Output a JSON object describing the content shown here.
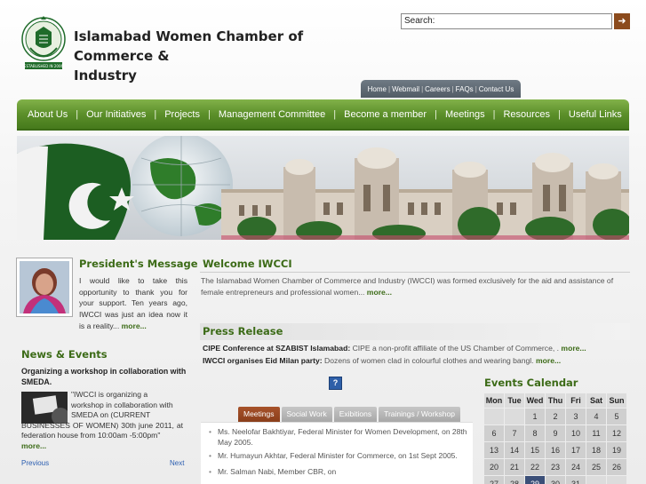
{
  "header": {
    "title_line1": "Islamabad Women Chamber of Commerce &",
    "title_line2": "Industry",
    "logo_caption": "ESTABLISHED IN 2006"
  },
  "search": {
    "label": "Search:",
    "value": "",
    "go_label": "➜"
  },
  "top_links": [
    "Home",
    "Webmail",
    "Careers",
    "FAQs",
    "Contact Us"
  ],
  "nav": [
    "About Us",
    "Our Initiatives",
    "Projects",
    "Management Committee",
    "Become a member",
    "Meetings",
    "Resources",
    "Useful Links"
  ],
  "president": {
    "title": "President's Message",
    "text": "I would like to take this opportunity to thank you for your support. Ten years ago, IWCCI was just an idea now it is a reality...",
    "more": "more..."
  },
  "welcome": {
    "title": "Welcome IWCCI",
    "text": "The Islamabad Women Chamber of Commerce and Industry (IWCCI) was formed exclusively for the aid and assistance of female entrepreneurs and professional women...",
    "more": "more..."
  },
  "press": {
    "title": "Press Release",
    "items": [
      {
        "bold": "CIPE Conference at SZABIST Islamabad:",
        "text": " CIPE a non-profit affiliate of the US Chamber of Commerce, .",
        "more": "more..."
      },
      {
        "bold": "IWCCI organises Eid Milan party:",
        "text": " Dozens of women clad in colourful clothes and wearing bangl.",
        "more": "more..."
      }
    ]
  },
  "news": {
    "title": "News & Events",
    "headline": "Organizing a workshop in collaboration with SMEDA.",
    "body_line1": "\"IWCCI is organizing a",
    "body_line2": "workshop in collaboration with",
    "body_line3": "SMEDA on (CURRENT",
    "body_rest": "BUSINESSES OF WOMEN) 30th june 2011, at federation house from 10:00am -5:00pm\"",
    "more": "more...",
    "prev": "Previous",
    "next": "Next"
  },
  "help_label": "?",
  "tabs": [
    {
      "label": "Meetings",
      "active": true
    },
    {
      "label": "Social Work",
      "active": false
    },
    {
      "label": "Exibitions",
      "active": false
    },
    {
      "label": "Trainings / Workshop",
      "active": false
    }
  ],
  "meetings": [
    "Ms. Neelofar Bakhtiyar, Federal Minister for Women Development, on 28th May 2005.",
    "Mr. Humayun Akhtar, Federal Minister for Commerce, on 1st Sept 2005.",
    "Mr. Salman Nabi, Member CBR, on"
  ],
  "calendar": {
    "title": "Events Calendar",
    "days": [
      "Mon",
      "Tue",
      "Wed",
      "Thu",
      "Fri",
      "Sat",
      "Sun"
    ],
    "weeks": [
      [
        "",
        "",
        "1",
        "2",
        "3",
        "4",
        "5"
      ],
      [
        "6",
        "7",
        "8",
        "9",
        "10",
        "11",
        "12"
      ],
      [
        "13",
        "14",
        "15",
        "16",
        "17",
        "18",
        "19"
      ],
      [
        "20",
        "21",
        "22",
        "23",
        "24",
        "25",
        "26"
      ],
      [
        "27",
        "28",
        "29",
        "30",
        "31",
        "",
        ""
      ]
    ],
    "today": "29"
  },
  "colors": {
    "nav_green": "#5c8f2a",
    "heading_green": "#3c6b17",
    "active_tab": "#8a3e1a",
    "link_blue": "#2a5db0"
  }
}
